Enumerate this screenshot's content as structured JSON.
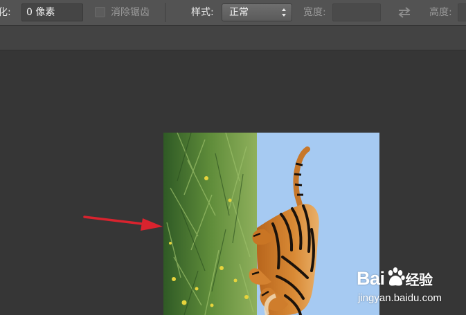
{
  "options_bar": {
    "feather_label": "羽化:",
    "feather_label_visible": "化:",
    "feather_value": "0 像素",
    "antialias_label": "消除锯齿",
    "style_label": "样式:",
    "style_value": "正常",
    "width_label": "宽度:",
    "width_value": "",
    "height_label": "高度:",
    "height_value": ""
  },
  "icons": {
    "style_dropdown": "chevron-updown-icon",
    "swap": "swap-arrows-icon",
    "antialias": "checkbox-icon"
  },
  "watermark": {
    "brand_left": "Bai",
    "brand_right": "经验",
    "url": "jingyan.baidu.com"
  },
  "colors": {
    "toolbar_bg": "#535353",
    "canvas_bg": "#363636",
    "arrow": "#d9232e",
    "sky": "#9fc4f0"
  }
}
